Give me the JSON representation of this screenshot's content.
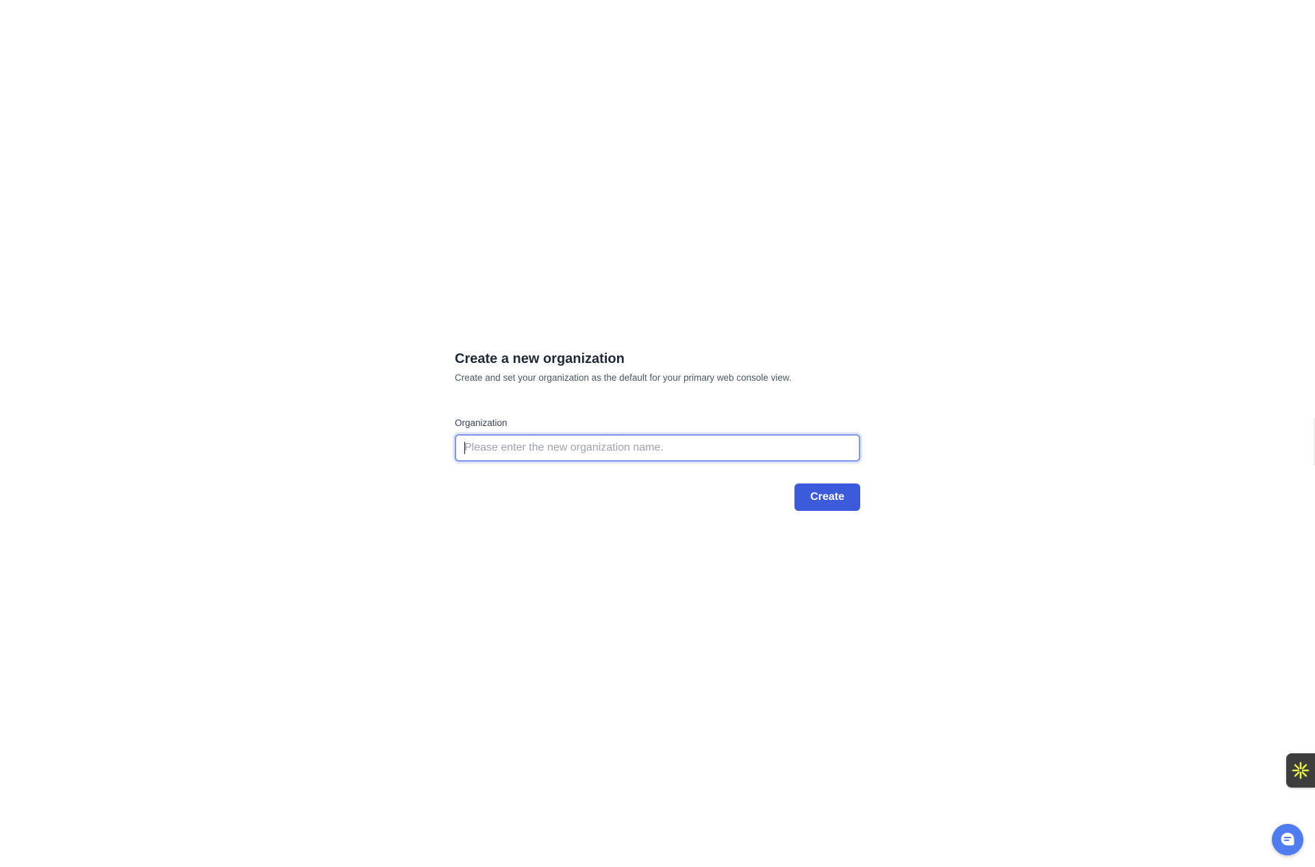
{
  "form": {
    "title": "Create a new organization",
    "subtitle": "Create and set your organization as the default for your primary web console view.",
    "organization_label": "Organization",
    "organization_value": "",
    "organization_placeholder": "Please enter the new organization name.",
    "create_label": "Create"
  },
  "widgets": {
    "side_widget_icon": "sparkle-icon",
    "chat_icon": "chat-bubble-icon"
  },
  "colors": {
    "primary": "#3b5bdb",
    "focus_ring": "#7c93e8",
    "chat": "#4f7df0",
    "sparkle": "#e6f04a"
  }
}
